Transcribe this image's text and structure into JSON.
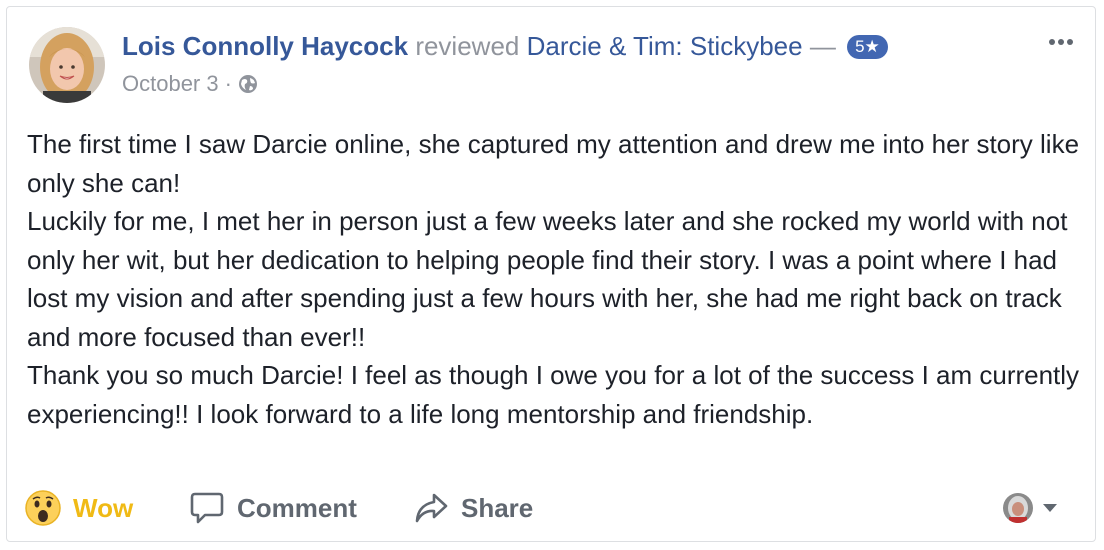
{
  "post": {
    "author_name": "Lois Connolly Haycock",
    "verb": "reviewed",
    "page_name": "Darcie & Tim: Stickybee",
    "dash": "—",
    "rating": "5★",
    "date": "October 3",
    "separator": "·",
    "privacy_icon": "globe-icon",
    "more_icon": "more-dots-icon",
    "paragraphs": [
      "The first time I saw Darcie online, she captured my attention and drew me into her story like only she can!",
      "Luckily for me, I met her in person just a few weeks later and she rocked my world with not only her wit, but her dedication to helping people find their story. I was a point where I had lost my vision and after spending just a few hours with her, she had me right back on track and more focused than ever!!",
      "Thank you so much Darcie! I feel as though I owe you for a lot of the success I am currently experiencing!! I look forward to a life long mentorship and friendship."
    ]
  },
  "actions": {
    "reaction_label": "Wow",
    "reaction_icon": "wow-emoji-icon",
    "comment_label": "Comment",
    "comment_icon": "comment-bubble-icon",
    "share_label": "Share",
    "share_icon": "share-arrow-icon",
    "viewer_icon": "viewer-avatar",
    "dropdown_icon": "caret-down-icon"
  },
  "colors": {
    "link_blue": "#365899",
    "meta_gray": "#90949c",
    "text": "#1d2129",
    "action_gray": "#606770",
    "wow_yellow": "#f0ba15",
    "badge_blue": "#4267b2",
    "border": "#dddfe2"
  }
}
